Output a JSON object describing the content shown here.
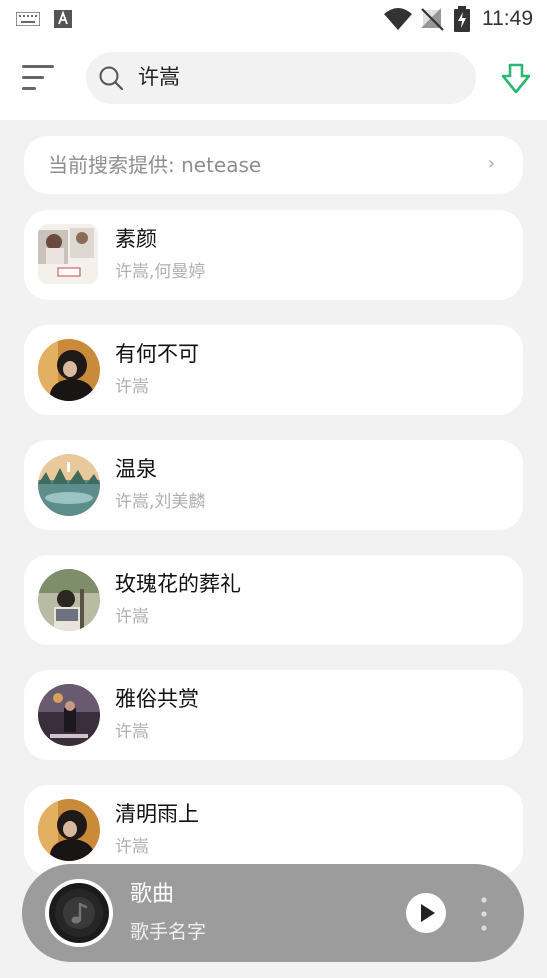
{
  "status_bar": {
    "time": "11:49",
    "icons": [
      "keyboard-icon",
      "a-badge-icon",
      "wifi-icon",
      "no-signal-icon",
      "battery-charging-icon"
    ]
  },
  "header": {
    "search_value": "许嵩",
    "menu_icon": "menu-icon",
    "search_icon": "search-icon",
    "download_icon": "download-icon",
    "accent_color": "#2bb673"
  },
  "source": {
    "label": "当前搜索提供: netease",
    "chevron": "›"
  },
  "songs": [
    {
      "title": "素颜",
      "artist": "许嵩,何曼婷"
    },
    {
      "title": "有何不可",
      "artist": "许嵩"
    },
    {
      "title": "温泉",
      "artist": "许嵩,刘美麟"
    },
    {
      "title": "玫瑰花的葬礼",
      "artist": "许嵩"
    },
    {
      "title": "雅俗共赏",
      "artist": "许嵩"
    },
    {
      "title": "清明雨上",
      "artist": "许嵩"
    }
  ],
  "player": {
    "title": "歌曲",
    "artist": "歌手名字",
    "background_color": "#9c9c9c"
  }
}
